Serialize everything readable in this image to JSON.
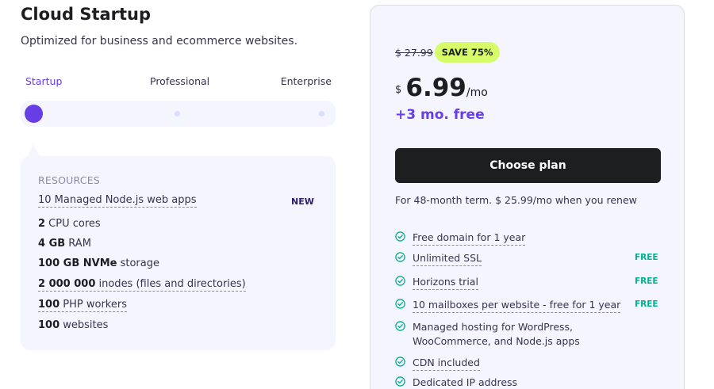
{
  "plan": {
    "title": "Cloud Startup",
    "subtitle": "Optimized for business and ecommerce websites."
  },
  "tiers": {
    "selected": "Startup",
    "items": [
      {
        "label": "Startup"
      },
      {
        "label": "Professional"
      },
      {
        "label": "Enterprise"
      }
    ]
  },
  "resources": {
    "heading": "RESOURCES",
    "new_badge": "NEW",
    "items": [
      {
        "bold": "10",
        "text": " Managed Node.js web apps"
      },
      {
        "bold": "2",
        "text": " CPU cores"
      },
      {
        "bold": "4 GB",
        "text": " RAM"
      },
      {
        "bold": "100 GB NVMe",
        "text": " storage"
      },
      {
        "bold": "2 000 000",
        "text": " inodes (files and directories)"
      },
      {
        "bold": "100",
        "text": " PHP workers"
      },
      {
        "bold": "100",
        "text": " websites"
      }
    ]
  },
  "pricing": {
    "old_price": "$ 27.99",
    "save_badge": "SAVE 75%",
    "currency": "$",
    "price": "6.99",
    "period": "/mo",
    "free_months": "+3 mo. free",
    "cta": "Choose plan",
    "term_note": "For 48-month term. $ 25.99/mo when you renew"
  },
  "features": [
    {
      "text": "Free domain for 1 year",
      "badge": ""
    },
    {
      "text": "Unlimited SSL",
      "badge": "FREE"
    },
    {
      "text": "Horizons trial",
      "badge": "FREE"
    },
    {
      "text": "10 mailboxes per website - free for 1 year",
      "badge": "FREE"
    },
    {
      "text": "Managed hosting for WordPress, WooCommerce, and Node.js apps",
      "badge": ""
    },
    {
      "text": "CDN included",
      "badge": ""
    },
    {
      "text": "Dedicated IP address",
      "badge": ""
    }
  ],
  "colors": {
    "accent": "#673de6",
    "check": "#00b090",
    "badge_bg": "#d6fc6a",
    "cta_bg": "#1d1e20"
  },
  "icons": {
    "feature_check": "check-circle-icon"
  }
}
